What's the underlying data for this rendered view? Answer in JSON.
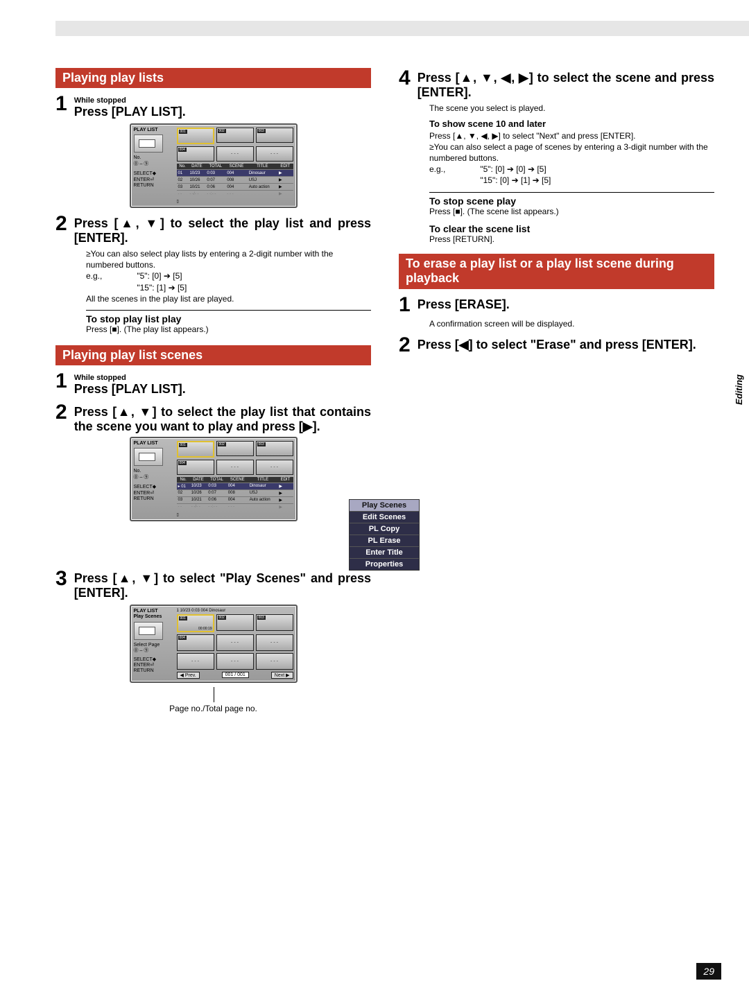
{
  "side_tab": "Editing",
  "page_number": "29",
  "left": {
    "sec1_title": "Playing play lists",
    "s1": {
      "sub": "While stopped",
      "main": "Press [PLAY LIST]."
    },
    "osd1": {
      "label": "PLAY LIST",
      "heads": [
        "No.",
        "DATE",
        "TOTAL",
        "SCENE",
        "TITLE",
        "EDIT"
      ],
      "rows": [
        {
          "no": "01",
          "date": "10/23",
          "total": "0:03",
          "scene": "004",
          "title": "Dinosaur"
        },
        {
          "no": "02",
          "date": "10/26",
          "total": "0:07",
          "scene": "008",
          "title": "USJ"
        },
        {
          "no": "03",
          "date": "10/21",
          "total": "0:06",
          "scene": "004",
          "title": "Auto action"
        },
        {
          "no": "- -",
          "date": "- -/- -",
          "total": "- -:- -",
          "scene": "- - -",
          "title": ""
        }
      ],
      "thumbs": [
        "001",
        "002",
        "003",
        "004",
        "- - -",
        "- - -"
      ]
    },
    "s2": {
      "main": "Press [▲, ▼] to select the play list and press [ENTER]."
    },
    "s2notes": {
      "a": "≥You can also select play lists by entering a 2-digit number with the numbered buttons.",
      "b": "e.g.,",
      "c": "\"5\":   [0] ➔ [5]",
      "d": "\"15\": [1] ➔ [5]",
      "e": "All the scenes in the play list are played."
    },
    "stop1_head": "To stop play list play",
    "stop1_body": "Press [■]. (The play list appears.)",
    "sec2_title": "Playing play list scenes",
    "s2_1": {
      "sub": "While stopped",
      "main": "Press [PLAY LIST]."
    },
    "s2_2": {
      "main": "Press [▲, ▼] to select the play list that contains the scene you want to play and press [▶]."
    },
    "ctx": {
      "m1": "Play Scenes",
      "m2": "Edit Scenes",
      "m3": "PL Copy",
      "m4": "PL Erase",
      "m5": "Enter Title",
      "m6": "Properties"
    },
    "s2_3": {
      "main": "Press [▲, ▼] to select \"Play Scenes\" and press [ENTER]."
    },
    "osd3": {
      "label": "PLAY LIST",
      "sub": "Play Scenes",
      "info": "1 10/23 0:03 004      Dinosaur",
      "select": "Select Page",
      "prev": "◀ Prev.",
      "page": "001 / 001",
      "next": "Next ▶"
    },
    "callout": "Page no./Total page no."
  },
  "right": {
    "s4": {
      "main": "Press [▲, ▼, ◀, ▶] to select the scene and press [ENTER]."
    },
    "s4notes": {
      "a": "The scene you select is played.",
      "b": "To show scene 10 and later",
      "c": "Press [▲, ▼, ◀, ▶] to select \"Next\" and press [ENTER].",
      "d": "≥You can also select a page of scenes by entering a 3-digit number with the numbered buttons.",
      "e": "e.g.,",
      "f": "\"5\":   [0] ➔ [0] ➔ [5]",
      "g": "\"15\": [0] ➔ [1] ➔ [5]"
    },
    "stop2_head": "To stop scene play",
    "stop2_body": "Press [■]. (The scene list appears.)",
    "clear_head": "To clear the scene list",
    "clear_body": "Press [RETURN].",
    "sec3_title": "To erase a play list or a play list scene during playback",
    "e1": {
      "main": "Press [ERASE]."
    },
    "e1_note": "A confirmation screen will be displayed.",
    "e2": {
      "main": "Press [◀] to select \"Erase\" and press [ENTER]."
    }
  }
}
